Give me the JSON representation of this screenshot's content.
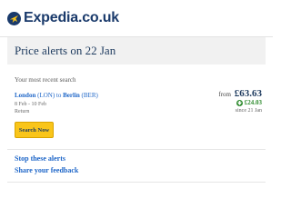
{
  "brand": {
    "name": "Expedia.co.uk"
  },
  "banner": {
    "title": "Price alerts on 22 Jan"
  },
  "recent": {
    "label": "Your most recent search",
    "origin_city": "London",
    "origin_code": "(LON)",
    "connector": "to",
    "dest_city": "Berlin",
    "dest_code": "(BER)",
    "dates": "8 Feb - 10 Feb",
    "trip_type": "Return",
    "from_label": "from",
    "price": "£63.63",
    "drop": "£24.03",
    "since": "since 21 Jan",
    "search_button": "Search Now"
  },
  "links": {
    "stop": "Stop these alerts",
    "feedback": "Share your feedback"
  },
  "colors": {
    "brand": "#1a3a6b",
    "link": "#1e66c8",
    "button": "#f9c51a",
    "drop": "#2e8b2e"
  }
}
